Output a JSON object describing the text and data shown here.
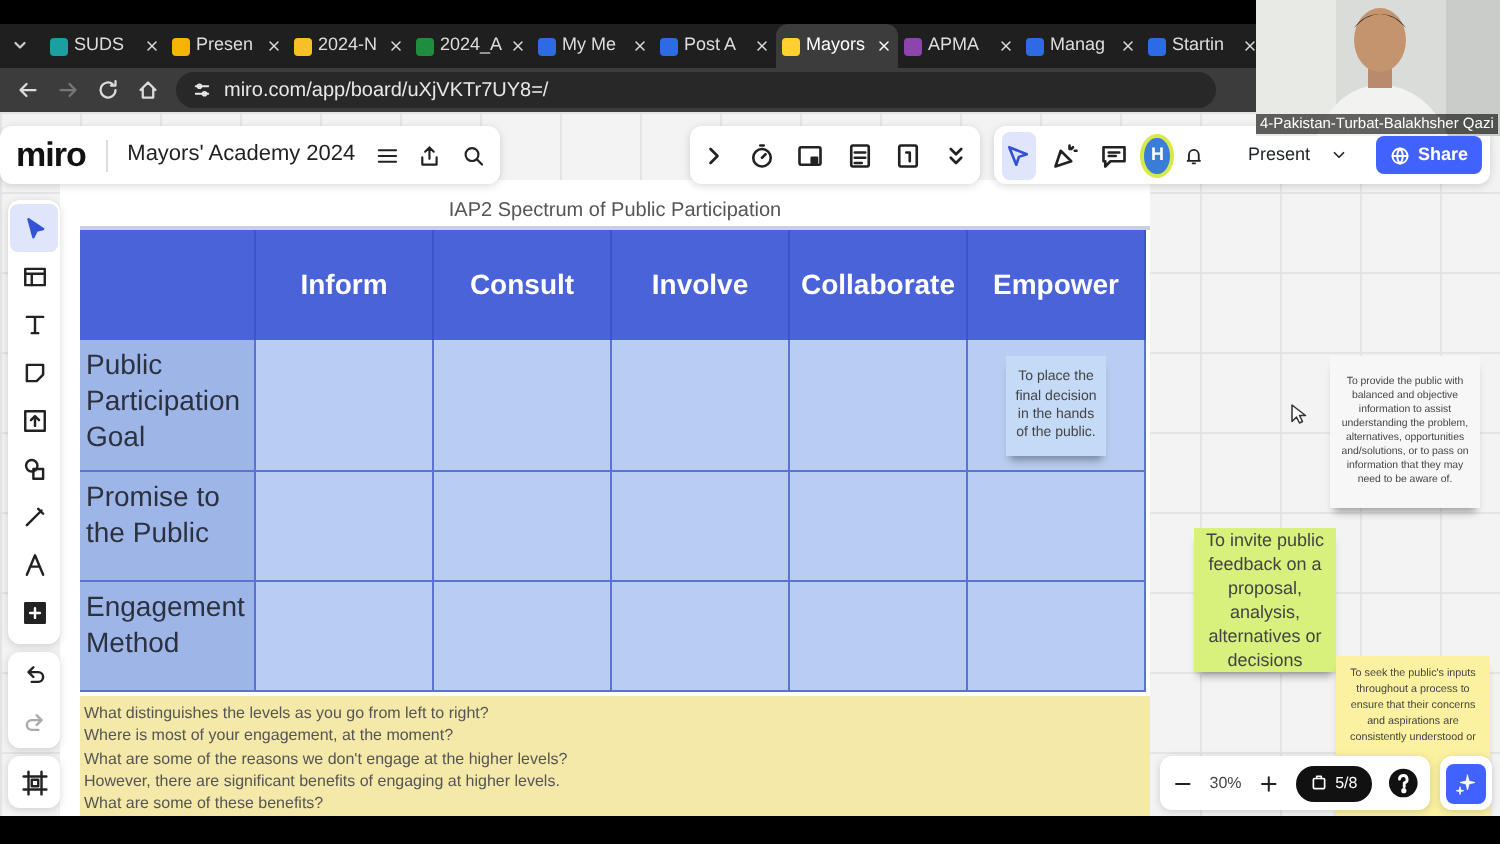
{
  "browser": {
    "tabs": [
      {
        "label": "SUDS",
        "selected": false,
        "color": "#1aa0a0"
      },
      {
        "label": "Presen",
        "selected": false,
        "color": "#f4b400"
      },
      {
        "label": "2024-N",
        "selected": false,
        "color": "#f6c026"
      },
      {
        "label": "2024_A",
        "selected": false,
        "color": "#1e8e3e"
      },
      {
        "label": "My Me",
        "selected": false,
        "color": "#2d6be4"
      },
      {
        "label": "Post A",
        "selected": false,
        "color": "#2d6be4"
      },
      {
        "label": "Mayors",
        "selected": true,
        "color": "#ffd02f"
      },
      {
        "label": "APMA",
        "selected": false,
        "color": "#8e44ad"
      },
      {
        "label": "Manag",
        "selected": false,
        "color": "#2d6be4"
      },
      {
        "label": "Startin",
        "selected": false,
        "color": "#2d6be4"
      }
    ],
    "address": "miro.com/app/board/uXjVKTr7UY8=/"
  },
  "video": {
    "name": "4-Pakistan-Turbat-Balakhsher Qazi"
  },
  "miro": {
    "logo": "miro",
    "board_title": "Mayors' Academy 2024",
    "present": "Present",
    "share": "Share",
    "avatar": "H",
    "collab_tools": [
      {
        "selected": false
      },
      {
        "selected": false
      },
      {
        "selected": false
      },
      {
        "selected": false
      },
      {
        "selected": false
      },
      {
        "selected": false
      },
      {
        "selected": true
      },
      {
        "selected": false
      },
      {
        "selected": false
      }
    ],
    "left_tools": [
      {
        "selected": true
      },
      {
        "selected": false
      },
      {
        "selected": false
      },
      {
        "selected": false
      },
      {
        "selected": false
      },
      {
        "selected": false
      },
      {
        "selected": false
      },
      {
        "selected": false
      },
      {
        "selected": false
      }
    ],
    "zoom": "30%",
    "page": "5/8"
  },
  "frame": {
    "title": "IAP2 Spectrum of Public Participation",
    "columns": [
      "Inform",
      "Consult",
      "Involve",
      "Collaborate",
      "Empower"
    ],
    "rows": [
      {
        "label": "Public Participation Goal",
        "cells": [
          {
            "kind": "empty"
          },
          {
            "kind": "empty"
          },
          {
            "kind": "empty"
          },
          {
            "kind": "empty"
          },
          {
            "kind": "note",
            "text": "To place the final decision in the hands of the public."
          }
        ]
      },
      {
        "label": "Promise to the Public",
        "cells": [
          {
            "kind": "empty"
          },
          {
            "kind": "empty"
          },
          {
            "kind": "empty"
          },
          {
            "kind": "empty"
          },
          {
            "kind": "empty"
          }
        ]
      },
      {
        "label": "Engagement Method",
        "cells": [
          {
            "kind": "empty"
          },
          {
            "kind": "empty"
          },
          {
            "kind": "empty"
          },
          {
            "kind": "empty"
          },
          {
            "kind": "empty"
          }
        ]
      }
    ],
    "questions": [
      "What distinguishes the levels as you go from left to right?",
      "Where is most of your engagement, at the moment?",
      "What are some of the reasons we don't engage at the higher levels?",
      "However, there are significant benefits of engaging at higher levels.",
      "What are some of these benefits?"
    ]
  },
  "canvas_notes": [
    {
      "text": "To provide the public with balanced and objective information to assist understanding the problem, alternatives, opportunities and/solutions, or to pass on information that they may need to be aware of.",
      "color": "#f7f7f7"
    },
    {
      "text": "To invite public feedback on a proposal, analysis, alternatives or decisions",
      "color": "#d8f07c"
    },
    {
      "text": "To seek the public's inputs throughout a process to ensure that their concerns and aspirations are consistently understood or",
      "color": "#fbf1a0"
    }
  ]
}
